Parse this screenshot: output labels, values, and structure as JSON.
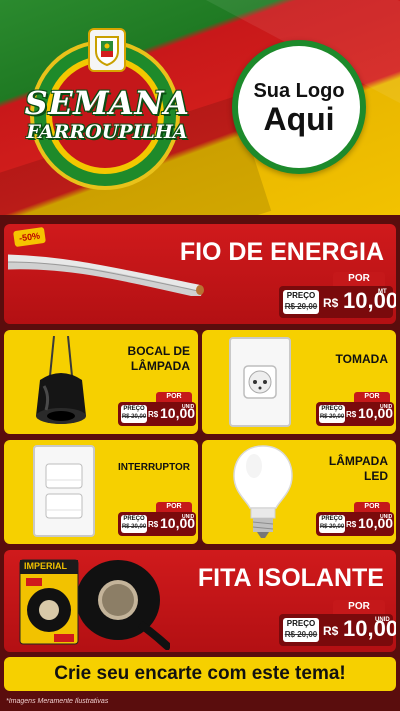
{
  "header": {
    "title_line1": "SEMANA",
    "title_line2": "FARROUPILHA",
    "logo_line1": "Sua Logo",
    "logo_line2": "Aqui"
  },
  "products": {
    "fio": {
      "title": "FIO DE ENERGIA",
      "badge": "-50%",
      "por": "POR",
      "old_label": "PREÇO",
      "old_value": "R$ 20,00",
      "currency": "R$",
      "price": "10,00",
      "unit": "MT"
    },
    "bocal": {
      "title_line1": "BOCAL DE",
      "title_line2": "LÂMPADA",
      "por": "POR",
      "old_label": "PREÇO",
      "old_value": "R$ 20,00",
      "currency": "R$",
      "price": "10,00",
      "unit": "UNID"
    },
    "tomada": {
      "title": "TOMADA",
      "por": "POR",
      "old_label": "PREÇO",
      "old_value": "R$ 20,00",
      "currency": "R$",
      "price": "10,00",
      "unit": "UNID"
    },
    "interruptor": {
      "title": "INTERRUPTOR",
      "por": "POR",
      "old_label": "PREÇO",
      "old_value": "R$ 20,00",
      "currency": "R$",
      "price": "10,00",
      "unit": "UNID"
    },
    "lampada": {
      "title_line1": "LÂMPADA",
      "title_line2": "LED",
      "por": "POR",
      "old_label": "PREÇO",
      "old_value": "R$ 20,00",
      "currency": "R$",
      "price": "10,00",
      "unit": "UNID"
    },
    "fita": {
      "title": "FITA ISOLANTE",
      "brand": "IMPERIAL",
      "por": "POR",
      "old_label": "PREÇO",
      "old_value": "R$ 20,00",
      "currency": "R$",
      "price": "10,00",
      "unit": "UNID"
    }
  },
  "banner": "Crie seu encarte com este tema!",
  "footnote": "*Imagens Meramente Ilustrativas",
  "colors": {
    "red": "#c8181a",
    "dark_red": "#7a0a0c",
    "yellow": "#f6d000",
    "green": "#1e8a2a"
  }
}
